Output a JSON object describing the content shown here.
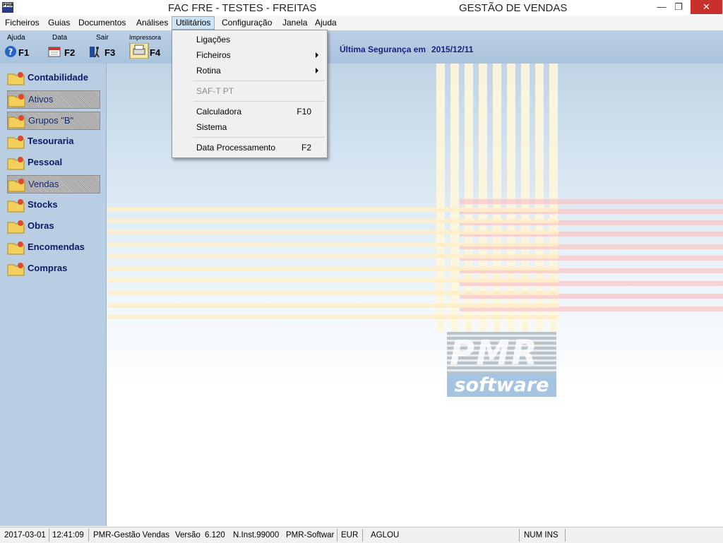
{
  "window": {
    "icon_label": "PMR",
    "title": "FAC FRE - TESTES - FREITAS",
    "module": "GESTÃO DE VENDAS",
    "minimize": "—",
    "maximize": "❐",
    "close": "✕"
  },
  "menubar": [
    "Ficheiros",
    "Guias",
    "Documentos",
    "Análises",
    "Utilitários",
    "Configuração",
    "Janela",
    "Ajuda"
  ],
  "toolbar": {
    "help": {
      "label": "Ajuda",
      "key": "F1"
    },
    "date": {
      "label": "Data",
      "key": "F2"
    },
    "exit": {
      "label": "Sair",
      "key": "F3"
    },
    "printer": {
      "label": "Impressora",
      "key": "F4"
    },
    "security_label": "Última Segurança em",
    "security_date": "2015/12/11"
  },
  "sidebar": [
    {
      "label": "Contabilidade",
      "enabled": true
    },
    {
      "label": "Ativos",
      "enabled": false
    },
    {
      "label": "Grupos \"B\"",
      "enabled": false
    },
    {
      "label": "Tesouraria",
      "enabled": true
    },
    {
      "label": "Pessoal",
      "enabled": true
    },
    {
      "label": "Vendas",
      "enabled": false
    },
    {
      "label": "Stocks",
      "enabled": true
    },
    {
      "label": "Obras",
      "enabled": true
    },
    {
      "label": "Encomendas",
      "enabled": true
    },
    {
      "label": "Compras",
      "enabled": true
    }
  ],
  "dropdown": {
    "items": [
      {
        "label": "Ligações",
        "shortcut": "",
        "submenu": false,
        "enabled": true
      },
      {
        "label": "Ficheiros",
        "shortcut": "",
        "submenu": true,
        "enabled": true
      },
      {
        "label": "Rotina",
        "shortcut": "",
        "submenu": true,
        "enabled": true
      },
      {
        "label": "SAF-T PT",
        "shortcut": "",
        "submenu": false,
        "enabled": false
      },
      {
        "label": "Calculadora",
        "shortcut": "F10",
        "submenu": false,
        "enabled": true
      },
      {
        "label": "Sistema",
        "shortcut": "",
        "submenu": false,
        "enabled": true
      },
      {
        "label": "Data Processamento",
        "shortcut": "F2",
        "submenu": false,
        "enabled": true
      }
    ]
  },
  "logo": {
    "top": "PMR",
    "bottom": "software"
  },
  "statusbar": {
    "date": "2017-03-01",
    "time": "12:41:09",
    "app": "PMR-Gestão Vendas",
    "version_label": "Versão",
    "version": "6.120",
    "install": "N.Inst.99000",
    "vendor": "PMR-Softwar",
    "currency": "EUR",
    "user": "AGLOU",
    "keys": "NUM INS"
  },
  "colors": {
    "accent": "#1a237e",
    "sidebar_bg": "#b9cde3",
    "toolbar_bg": "#a9c2dc",
    "close_btn": "#c7302b"
  }
}
